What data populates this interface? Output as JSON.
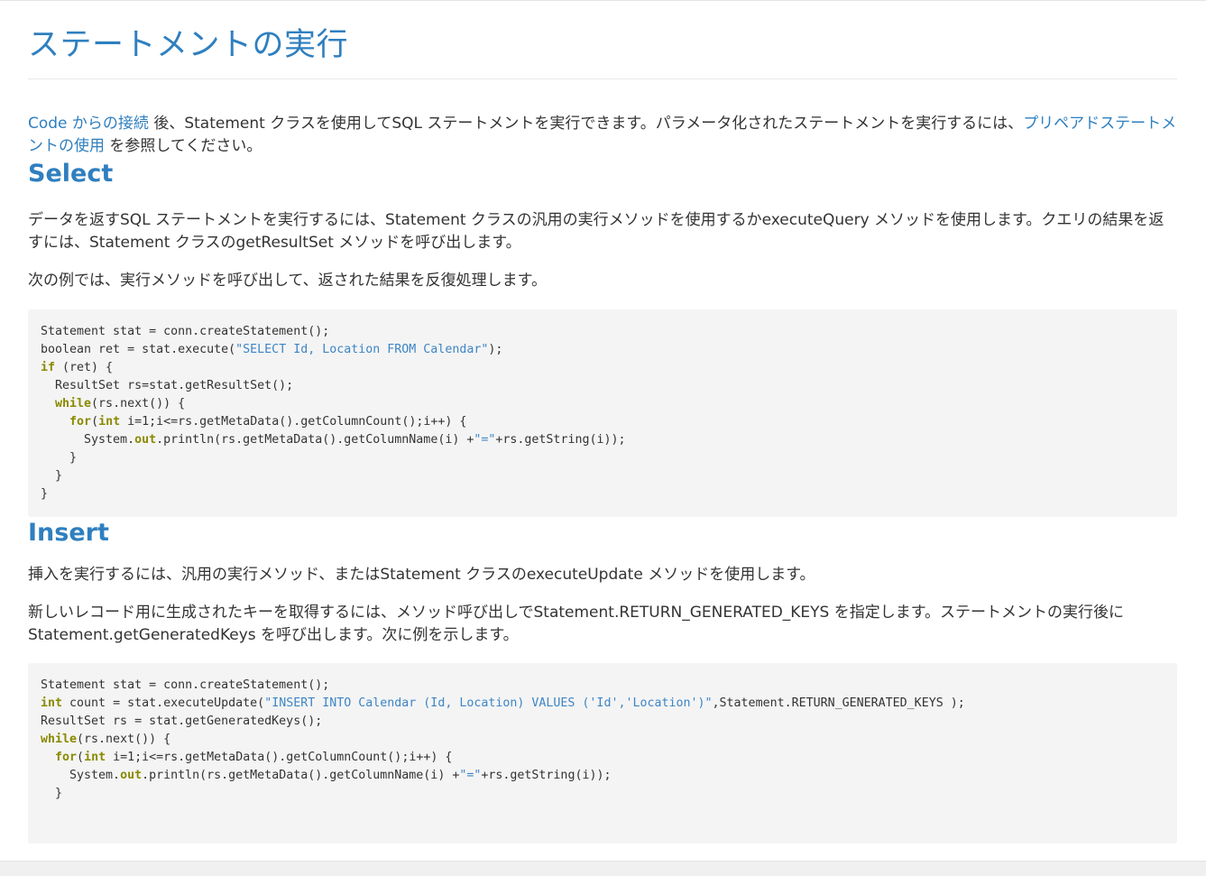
{
  "page": {
    "title": "ステートメントの実行"
  },
  "intro": {
    "link1": "Code からの接続",
    "text1": " 後、Statement クラスを使用してSQL ステートメントを実行できます。パラメータ化されたステートメントを実行するには、",
    "link2": "プリペアドステートメントの使用",
    "text2": " を参照してください。"
  },
  "select": {
    "heading": "Select",
    "p1": "データを返すSQL ステートメントを実行するには、Statement クラスの汎用の実行メソッドを使用するかexecuteQuery メソッドを使用します。クエリの結果を返すには、Statement クラスのgetResultSet メソッドを呼び出します。",
    "p2": "次の例では、実行メソッドを呼び出して、返された結果を反復処理します。",
    "code": {
      "l1": "Statement stat = conn.createStatement();",
      "l2a": "boolean ret = stat.execute(",
      "l2s": "\"SELECT Id, Location FROM Calendar\"",
      "l2b": ");",
      "l3k": "if",
      "l3b": " (ret) {",
      "l4": "  ResultSet rs=stat.getResultSet();",
      "l5i": "  ",
      "l5k": "while",
      "l5b": "(rs.next()) {",
      "l6i": "    ",
      "l6k1": "for",
      "l6p": "(",
      "l6k2": "int",
      "l6b": " i=1;i<=rs.getMetaData().getColumnCount();i++) {",
      "l7a": "      System.",
      "l7k": "out",
      "l7b": ".println(rs.getMetaData().getColumnName(i) +",
      "l7s": "\"=\"",
      "l7c": "+rs.getString(i));",
      "l8": "    }",
      "l9": "  }",
      "l10": "}"
    }
  },
  "insert": {
    "heading": "Insert",
    "p1": "挿入を実行するには、汎用の実行メソッド、またはStatement クラスのexecuteUpdate メソッドを使用します。",
    "p2": "新しいレコード用に生成されたキーを取得するには、メソッド呼び出しでStatement.RETURN_GENERATED_KEYS を指定します。ステートメントの実行後にStatement.getGeneratedKeys を呼び出します。次に例を示します。",
    "code": {
      "l1": "Statement stat = conn.createStatement();",
      "l2k": "int",
      "l2a": " count = stat.executeUpdate(",
      "l2s": "\"INSERT INTO Calendar (Id, Location) VALUES ('Id','Location')\"",
      "l2b": ",Statement.RETURN_GENERATED_KEYS );",
      "l3": "ResultSet rs = stat.getGeneratedKeys();",
      "l4k": "while",
      "l4b": "(rs.next()) {",
      "l5i": "  ",
      "l5k1": "for",
      "l5p": "(",
      "l5k2": "int",
      "l5b": " i=1;i<=rs.getMetaData().getColumnCount();i++) {",
      "l6a": "    System.",
      "l6k": "out",
      "l6b": ".println(rs.getMetaData().getColumnName(i) +",
      "l6s": "\"=\"",
      "l6c": "+rs.getString(i));",
      "l7": "  }"
    }
  }
}
